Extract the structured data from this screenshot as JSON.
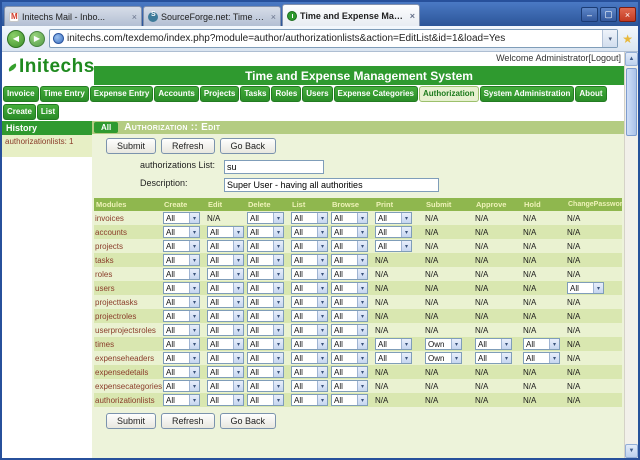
{
  "colors": {
    "brand-green": "#2f9a2f",
    "section-bar": "#b4cc82",
    "table-header-bg": "#8fb74e",
    "table-header-text": "#eef2b8",
    "row-light": "#eaf2d1",
    "row-dark": "#d9e7b0",
    "module-text": "#8a3c2a",
    "titlebar-blue": "#33609f",
    "close-red": "#d6492f"
  },
  "window": {
    "tabs": [
      {
        "label": "Initechs Mail - Inbo...",
        "icon": "mail-icon"
      },
      {
        "label": "SourceForge.net: Time and...",
        "icon": "sourceforge-icon"
      },
      {
        "label": "Time and Expense Manage...",
        "icon": "clock-icon"
      }
    ],
    "active_tab_index": 2,
    "url": "initechs.com/texdemo/index.php?module=author/authorizationlists&action=EditList&id=1&load=Yes"
  },
  "header": {
    "logo_text": "Initechs",
    "app_title": "Time and Expense Management System",
    "welcome_text": "Welcome Administrator",
    "logout_label": "[Logout]"
  },
  "menu": {
    "items": [
      "Invoice",
      "Time Entry",
      "Expense Entry",
      "Accounts",
      "Projects",
      "Tasks",
      "Roles",
      "Users",
      "Expense Categories",
      "Authorization",
      "System Administration",
      "About"
    ],
    "active_item": "Authorization"
  },
  "actions": {
    "items": [
      "Create",
      "List"
    ]
  },
  "sidebar": {
    "title": "History",
    "entry": "authorizationlists: 1"
  },
  "content": {
    "badge": "All",
    "section_title": "Authorization :: Edit",
    "toolbar_buttons": [
      "Submit",
      "Refresh",
      "Go Back"
    ],
    "fields": [
      {
        "label": "authorizations List:",
        "value": "su"
      },
      {
        "label": "Description:",
        "value": "Super User - having all authorities"
      }
    ],
    "table": {
      "columns": [
        "Modules",
        "Create",
        "Edit",
        "Delete",
        "List",
        "Browse",
        "Print",
        "Submit",
        "Approve",
        "Hold",
        "ChangePassword"
      ],
      "rows": [
        {
          "module": "invoices",
          "cells": [
            "All",
            "N/A",
            "All",
            "All",
            "All",
            "All",
            "N/A",
            "N/A",
            "N/A",
            "N/A"
          ]
        },
        {
          "module": "accounts",
          "cells": [
            "All",
            "All",
            "All",
            "All",
            "All",
            "All",
            "N/A",
            "N/A",
            "N/A",
            "N/A"
          ]
        },
        {
          "module": "projects",
          "cells": [
            "All",
            "All",
            "All",
            "All",
            "All",
            "All",
            "N/A",
            "N/A",
            "N/A",
            "N/A"
          ]
        },
        {
          "module": "tasks",
          "cells": [
            "All",
            "All",
            "All",
            "All",
            "All",
            "N/A",
            "N/A",
            "N/A",
            "N/A",
            "N/A"
          ]
        },
        {
          "module": "roles",
          "cells": [
            "All",
            "All",
            "All",
            "All",
            "All",
            "N/A",
            "N/A",
            "N/A",
            "N/A",
            "N/A"
          ]
        },
        {
          "module": "users",
          "cells": [
            "All",
            "All",
            "All",
            "All",
            "All",
            "N/A",
            "N/A",
            "N/A",
            "N/A",
            "All"
          ]
        },
        {
          "module": "projecttasks",
          "cells": [
            "All",
            "All",
            "All",
            "All",
            "All",
            "N/A",
            "N/A",
            "N/A",
            "N/A",
            "N/A"
          ]
        },
        {
          "module": "projectroles",
          "cells": [
            "All",
            "All",
            "All",
            "All",
            "All",
            "N/A",
            "N/A",
            "N/A",
            "N/A",
            "N/A"
          ]
        },
        {
          "module": "userprojectsroles",
          "cells": [
            "All",
            "All",
            "All",
            "All",
            "All",
            "N/A",
            "N/A",
            "N/A",
            "N/A",
            "N/A"
          ]
        },
        {
          "module": "times",
          "cells": [
            "All",
            "All",
            "All",
            "All",
            "All",
            "All",
            "Own",
            "All",
            "All",
            "N/A"
          ]
        },
        {
          "module": "expenseheaders",
          "cells": [
            "All",
            "All",
            "All",
            "All",
            "All",
            "All",
            "Own",
            "All",
            "All",
            "N/A"
          ]
        },
        {
          "module": "expensedetails",
          "cells": [
            "All",
            "All",
            "All",
            "All",
            "All",
            "N/A",
            "N/A",
            "N/A",
            "N/A",
            "N/A"
          ]
        },
        {
          "module": "expensecategories",
          "cells": [
            "All",
            "All",
            "All",
            "All",
            "All",
            "N/A",
            "N/A",
            "N/A",
            "N/A",
            "N/A"
          ]
        },
        {
          "module": "authorizationlists",
          "cells": [
            "All",
            "All",
            "All",
            "All",
            "All",
            "N/A",
            "N/A",
            "N/A",
            "N/A",
            "N/A"
          ]
        }
      ]
    },
    "footer_buttons": [
      "Submit",
      "Refresh",
      "Go Back"
    ]
  }
}
